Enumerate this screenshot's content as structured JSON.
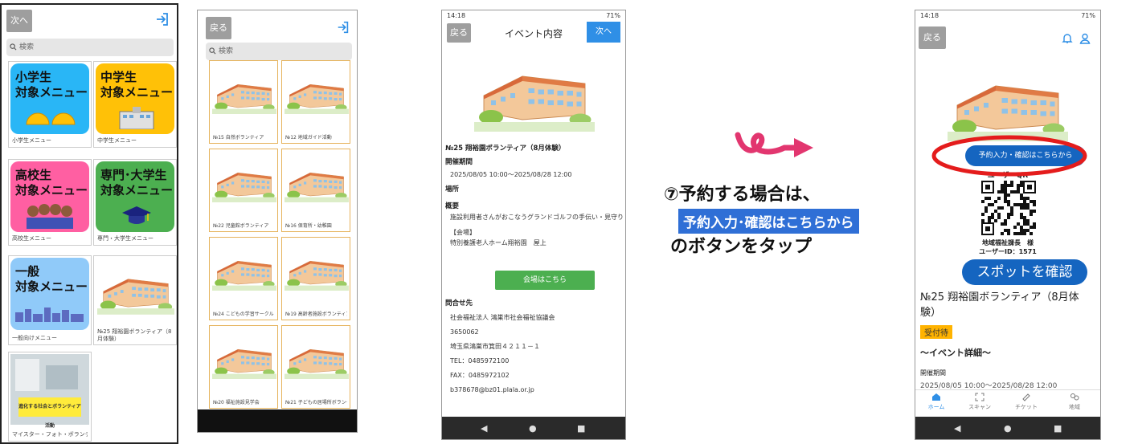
{
  "colors": {
    "blue": "#2f8fe6",
    "green": "#4caf50",
    "red": "#e41c1c",
    "navy": "#1565c0",
    "orange": "#ffb300"
  },
  "phone1": {
    "back": "次へ",
    "search_placeholder": "検索",
    "tiles": [
      {
        "line1": "小学生",
        "line2": "対象メニュー",
        "caption": "小学生メニュー",
        "color": "#29b6f6"
      },
      {
        "line1": "中学生",
        "line2": "対象メニュー",
        "caption": "中学生メニュー",
        "color": "#ffc107"
      },
      {
        "line1": "高校生",
        "line2": "対象メニュー",
        "caption": "高校生メニュー",
        "color": "#ff5fa2"
      },
      {
        "line1": "専門･大学生",
        "line2": "対象メニュー",
        "caption": "専門・大学生メニュー",
        "color": "#4caf50"
      },
      {
        "line1": "一般",
        "line2": "対象メニュー",
        "caption": "一般向けメニュー",
        "color": "#90caf9"
      }
    ],
    "event_caption": "№25 翔裕園ボランティア（8月体験）",
    "photo_caption": "マイスター・フォト・ボランティア",
    "photo_banner": "進化する社会とボランティア活動"
  },
  "phone2": {
    "back": "戻る",
    "search_placeholder": "検索",
    "captions": [
      "№15 自然ボランティア",
      "№12 地域ガイド活動",
      "№22 児童館ボランティア",
      "№16 保育所・幼稚園",
      "№24 こどもの学習サークル",
      "№19 高齢者施設ボランティア",
      "№20 福祉施設見学会",
      "№21 子どもの居場所ボランティア"
    ]
  },
  "phone3": {
    "time": "14:18",
    "battery": "71%",
    "back": "戻る",
    "title": "イベント内容",
    "next": "次へ",
    "event_name": "№25 翔裕園ボランティア（8月体験）",
    "period_label": "開催期間",
    "period": "2025/08/05 10:00～2025/08/28 12:00",
    "place_label": "場所",
    "outline_label": "概要",
    "outline": "施設利用者さんがおこなうグランドゴルフの手伝い・見守り",
    "venue_head": "【会場】",
    "venue": "特別養護老人ホーム翔裕園　屋上",
    "venue_button": "会場はこちら",
    "contact_label": "問合せ先",
    "org": "社会福祉法人 鴻巣市社会福祉協議会",
    "zip": "3650062",
    "address": "埼玉県鴻巣市箕田４２１１－１",
    "tel": "TEL：0485972100",
    "fax": "FAX：0485972102",
    "email": "b378678@bz01.plala.or.jp"
  },
  "note": {
    "line1": "⑦予約する場合は、",
    "highlight": "予約入力･確認はこちらから",
    "line3": "のボタンをタップ"
  },
  "phone4": {
    "time": "14:18",
    "battery": "71%",
    "back": "戻る",
    "reserve_button": "予約入力・確認はこちらから",
    "qr_label": "ユーザーQR",
    "user_name": "地域福祉課長　様",
    "user_id": "ユーザーID：1571",
    "spot_button": "スポットを確認",
    "event_name": "№25 翔裕園ボランティア（8月体験）",
    "status_badge": "受付待",
    "detail_head": "～イベント詳細～",
    "period_label": "開催期間",
    "period": "2025/08/05 10:00～2025/08/28 12:00",
    "tabs": [
      "ホーム",
      "スキャン",
      "チケット",
      "地域"
    ]
  }
}
